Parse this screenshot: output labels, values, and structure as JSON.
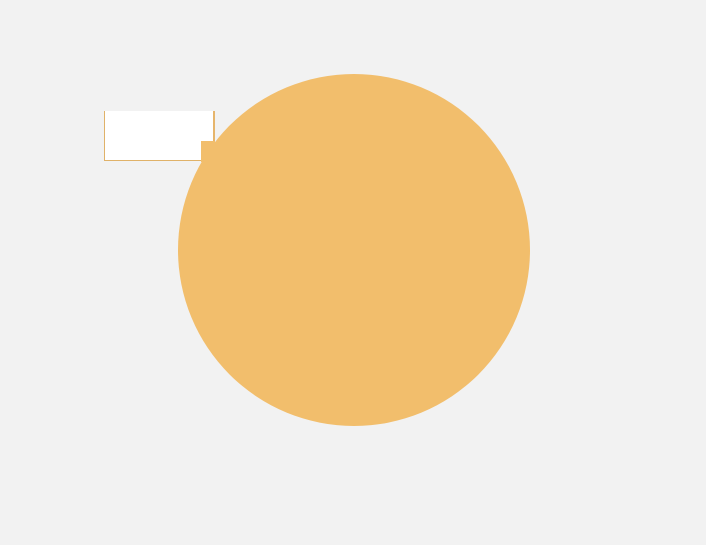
{
  "screen": {
    "background_color": "#f2f2f2"
  },
  "shape": {
    "type": "circle",
    "color": "#f2be6c"
  },
  "mini_window": {
    "background_color": "#ffffff",
    "border_color": "#e0b269"
  }
}
